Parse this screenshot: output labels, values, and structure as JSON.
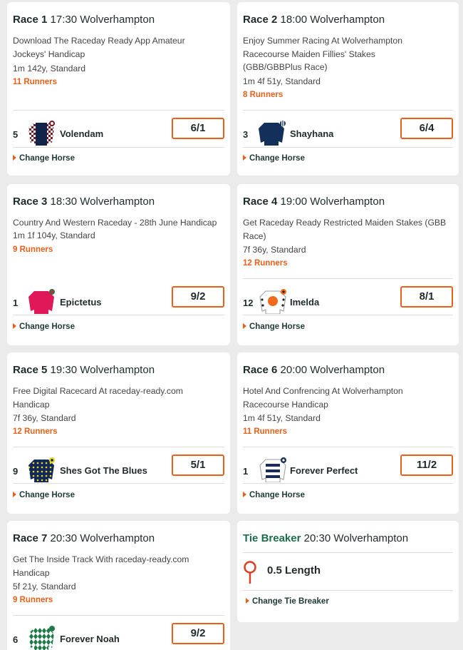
{
  "change_horse_label": "Change Horse",
  "races": [
    {
      "race_label": "Race 1",
      "time": "17:30",
      "course": "Wolverhampton",
      "description": "Download The Raceday Ready App Amateur Jockeys' Handicap",
      "distance": "1m 142y, Standard",
      "runners": "11 Runners",
      "selection": {
        "number": "5",
        "horse": "Volendam",
        "odds": "6/1",
        "silk_icon": "maroon-white-check-silk-icon"
      }
    },
    {
      "race_label": "Race 2",
      "time": "18:00",
      "course": "Wolverhampton",
      "description": "Enjoy Summer Racing At Wolverhampton Racecourse Maiden Fillies' Stakes (GBB/GBBPlus Race)",
      "distance": "1m 4f 51y, Standard",
      "runners": "8 Runners",
      "selection": {
        "number": "3",
        "horse": "Shayhana",
        "odds": "6/4",
        "silk_icon": "dark-blue-silk-icon"
      }
    },
    {
      "race_label": "Race 3",
      "time": "18:30",
      "course": "Wolverhampton",
      "description": "Country And Western Raceday - 28th June Handicap",
      "distance": "1m 1f 104y, Standard",
      "runners": "9 Runners",
      "selection": {
        "number": "1",
        "horse": "Epictetus",
        "odds": "9/2",
        "silk_icon": "pink-silk-icon"
      }
    },
    {
      "race_label": "Race 4",
      "time": "19:00",
      "course": "Wolverhampton",
      "description": "Get Raceday Ready Restricted Maiden Stakes (GBB Race)",
      "distance": "7f 36y, Standard",
      "runners": "12 Runners",
      "selection": {
        "number": "12",
        "horse": "Imelda",
        "odds": "8/1",
        "silk_icon": "white-orange-disc-silk-icon"
      }
    },
    {
      "race_label": "Race 5",
      "time": "19:30",
      "course": "Wolverhampton",
      "description": "Free Digital Racecard At raceday-ready.com Handicap",
      "distance": "7f 36y, Standard",
      "runners": "12 Runners",
      "selection": {
        "number": "9",
        "horse": "Shes Got The Blues",
        "odds": "5/1",
        "silk_icon": "navy-yellow-stars-silk-icon"
      }
    },
    {
      "race_label": "Race 6",
      "time": "20:00",
      "course": "Wolverhampton",
      "description": "Hotel And Confrencing At Wolverhampton Racecourse Handicap",
      "distance": "1m 4f 51y, Standard",
      "runners": "11 Runners",
      "selection": {
        "number": "1",
        "horse": "Forever Perfect",
        "odds": "11/2",
        "silk_icon": "white-navy-hoops-silk-icon"
      }
    },
    {
      "race_label": "Race 7",
      "time": "20:30",
      "course": "Wolverhampton",
      "description": "Get The Inside Track With raceday-ready.com Handicap",
      "distance": "5f 21y, Standard",
      "runners": "9 Runners",
      "selection": {
        "number": "6",
        "horse": "Forever Noah",
        "odds": "9/2",
        "silk_icon": "green-white-diamonds-silk-icon"
      }
    }
  ],
  "tie_breaker": {
    "label": "Tie Breaker",
    "time": "20:30",
    "course": "Wolverhampton",
    "value": "0.5 Length",
    "change_label": "Change Tie Breaker"
  },
  "colors": {
    "accent_orange": "#e8601a",
    "brand_green": "#1b6e4c",
    "text_dark": "#1f2a2a"
  }
}
